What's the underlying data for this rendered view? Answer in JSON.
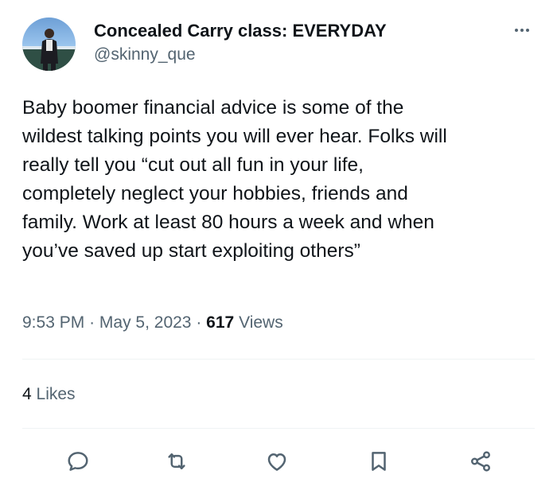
{
  "author": {
    "display_name": "Concealed Carry class: EVERYDAY",
    "handle": "@skinny_que",
    "avatar_icon": "profile-photo"
  },
  "tweet": {
    "text": "Baby boomer financial advice is some of the\nwildest talking points you will ever hear. Folks will\nreally tell you “cut out all fun in your life,\ncompletely neglect your hobbies, friends and\nfamily. Work at least 80 hours a week and when\nyou’ve saved up start exploiting others”",
    "time": "9:53 PM",
    "date": "May 5, 2023",
    "separator": "·",
    "views_count": "617",
    "views_label": "Views"
  },
  "engagement": {
    "likes_count": "4",
    "likes_label": "Likes"
  },
  "actions": [
    "reply-icon",
    "retweet-icon",
    "like-icon",
    "bookmark-icon",
    "share-icon"
  ],
  "colors": {
    "text": "#0f1419",
    "secondary": "#536471",
    "divider": "#eff3f4"
  }
}
